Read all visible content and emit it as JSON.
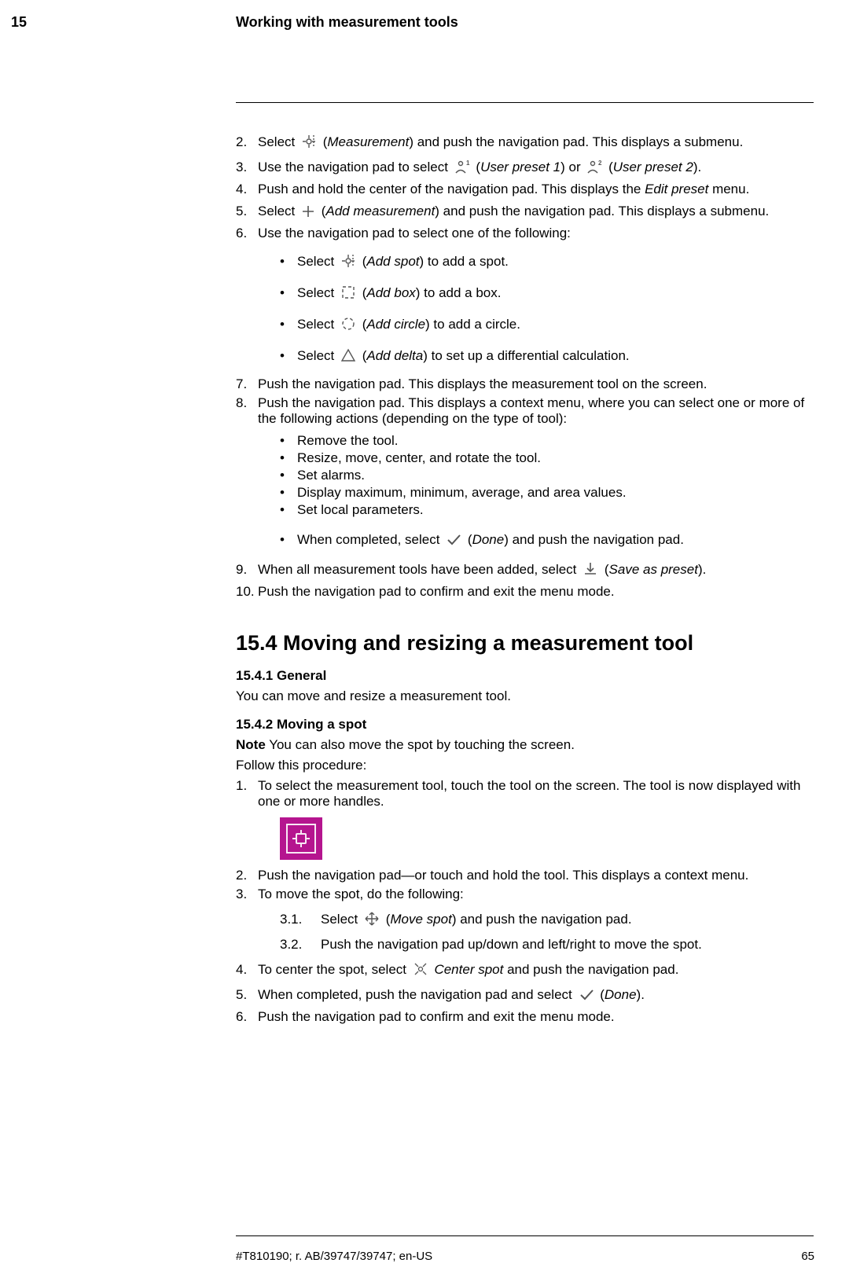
{
  "header": {
    "chapter_number": "15",
    "chapter_title": "Working with measurement tools"
  },
  "steps": {
    "s2a": "Select ",
    "s2b": " (",
    "s2c": "Measurement",
    "s2d": ") and push the navigation pad. This displays a submenu.",
    "s3a": "Use the navigation pad to select ",
    "s3b": " (",
    "s3c": "User preset 1",
    "s3d": ") or ",
    "s3e": " (",
    "s3f": "User preset 2",
    "s3g": ").",
    "s4a": "Push and hold the center of the navigation pad. This displays the ",
    "s4b": "Edit preset",
    "s4c": " menu.",
    "s5a": "Select ",
    "s5b": " (",
    "s5c": "Add measurement",
    "s5d": ") and push the navigation pad. This displays a submenu.",
    "s6": "Use the navigation pad to select one of the following:",
    "s6_1a": "Select ",
    "s6_1b": " (",
    "s6_1c": "Add spot",
    "s6_1d": ") to add a spot.",
    "s6_2a": "Select ",
    "s6_2b": " (",
    "s6_2c": "Add box",
    "s6_2d": ") to add a box.",
    "s6_3a": "Select ",
    "s6_3b": " (",
    "s6_3c": "Add circle",
    "s6_3d": ") to add a circle.",
    "s6_4a": "Select ",
    "s6_4b": " (",
    "s6_4c": "Add delta",
    "s6_4d": ") to set up a differential calculation.",
    "s7": "Push the navigation pad. This displays the measurement tool on the screen.",
    "s8": "Push the navigation pad. This displays a context menu, where you can select one or more of the following actions (depending on the type of tool):",
    "s8_b1": "Remove the tool.",
    "s8_b2": "Resize, move, center, and rotate the tool.",
    "s8_b3": "Set alarms.",
    "s8_b4": "Display maximum, minimum, average, and area values.",
    "s8_b5": "Set local parameters.",
    "s8_b6a": "When completed, select ",
    "s8_b6b": " (",
    "s8_b6c": "Done",
    "s8_b6d": ") and push the navigation pad.",
    "s9a": "When all measurement tools have been added, select ",
    "s9b": " (",
    "s9c": "Save as preset",
    "s9d": ").",
    "s10": "Push the navigation pad to confirm and exit the menu mode."
  },
  "section": {
    "heading": "15.4    Moving and resizing a measurement tool",
    "sub1_heading": "15.4.1    General",
    "sub1_text": "You can move and resize a measurement tool.",
    "sub2_heading": "15.4.2    Moving a spot",
    "sub2_note_label": "Note",
    "sub2_note_text": "    You can also move the spot by touching the screen.",
    "sub2_follow": "Follow this procedure:",
    "p1": "To select the measurement tool, touch the tool on the screen. The tool is now displayed with one or more handles.",
    "p2": "Push the navigation pad—or touch and hold the tool. This displays a context menu.",
    "p3": "To move the spot, do the following:",
    "p3_1a": "Select",
    "p3_1b": "(",
    "p3_1c": "Move spot",
    "p3_1d": ") and push the navigation pad.",
    "p3_2": "Push the navigation pad up/down and left/right to move the spot.",
    "p4a": "To center the spot, select ",
    "p4b": " ",
    "p4c": "Center spot",
    "p4d": " and push the navigation pad.",
    "p5a": "When completed, push the navigation pad and select ",
    "p5b": " (",
    "p5c": "Done",
    "p5d": ").",
    "p6": "Push the navigation pad to confirm and exit the menu mode."
  },
  "footer": {
    "docid": "#T810190; r. AB/39747/39747; en-US",
    "page": "65"
  }
}
